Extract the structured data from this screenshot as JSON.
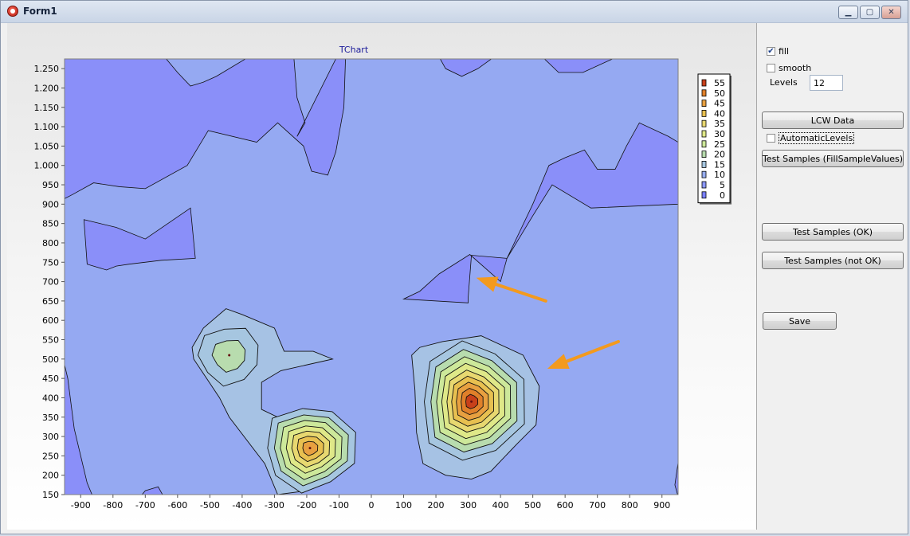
{
  "window": {
    "title": "Form1"
  },
  "controls": {
    "fill": {
      "label": "fill",
      "checked": true
    },
    "smooth": {
      "label": "smooth",
      "checked": false
    },
    "levels_label": "Levels",
    "levels_value": "12",
    "lcw_button": "LCW Data",
    "automatic_levels": {
      "label": "AutomaticLevels",
      "checked": false
    },
    "test_fill_button": "Test Samples (FillSampleValues)",
    "test_ok_button": "Test Samples (OK)",
    "test_not_ok_button": "Test Samples (not OK)",
    "save_button": "Save"
  },
  "chart_data": {
    "type": "contour",
    "title": "TChart",
    "xlabel": "",
    "ylabel": "",
    "xlim": [
      -950,
      950
    ],
    "ylim": [
      150,
      1275
    ],
    "x_ticks": [
      -900,
      -800,
      -700,
      -600,
      -500,
      -400,
      -300,
      -200,
      -100,
      0,
      100,
      200,
      300,
      400,
      500,
      600,
      700,
      800,
      900
    ],
    "y_ticks": [
      150,
      200,
      250,
      300,
      350,
      400,
      450,
      500,
      550,
      600,
      650,
      700,
      750,
      800,
      850,
      900,
      950,
      1000,
      1050,
      1100,
      1150,
      1200,
      1250
    ],
    "y_tick_labels": [
      "150",
      "200",
      "250",
      "300",
      "350",
      "400",
      "450",
      "500",
      "550",
      "600",
      "650",
      "700",
      "750",
      "800",
      "850",
      "900",
      "950",
      "1.000",
      "1.050",
      "1.100",
      "1.150",
      "1.200",
      "1.250"
    ],
    "levels": [
      55,
      50,
      45,
      40,
      35,
      30,
      25,
      20,
      15,
      10,
      5,
      0
    ],
    "legend": {
      "position": "right",
      "entries": [
        {
          "label": "55",
          "color": "#c8401a"
        },
        {
          "label": "50",
          "color": "#e0802a"
        },
        {
          "label": "45",
          "color": "#e8a040"
        },
        {
          "label": "40",
          "color": "#e8c050"
        },
        {
          "label": "35",
          "color": "#e8d870"
        },
        {
          "label": "30",
          "color": "#dfe888"
        },
        {
          "label": "25",
          "color": "#cde89a"
        },
        {
          "label": "20",
          "color": "#b8dcae"
        },
        {
          "label": "15",
          "color": "#a6c6e0"
        },
        {
          "label": "10",
          "color": "#98aef0"
        },
        {
          "label": "5",
          "color": "#8c98f8"
        },
        {
          "label": "0",
          "color": "#7a80ff"
        }
      ]
    },
    "peaks": [
      {
        "x": -440,
        "y": 510,
        "max_level": 20
      },
      {
        "x": -190,
        "y": 270,
        "max_level": 45
      },
      {
        "x": 310,
        "y": 390,
        "max_level": 55
      }
    ],
    "annotations": [
      {
        "type": "arrow",
        "color": "#f39a1e",
        "from": [
          540,
          650
        ],
        "to": [
          325,
          710
        ]
      },
      {
        "type": "arrow",
        "color": "#f39a1e",
        "from": [
          765,
          545
        ],
        "to": [
          545,
          475
        ]
      }
    ],
    "grid": false
  }
}
